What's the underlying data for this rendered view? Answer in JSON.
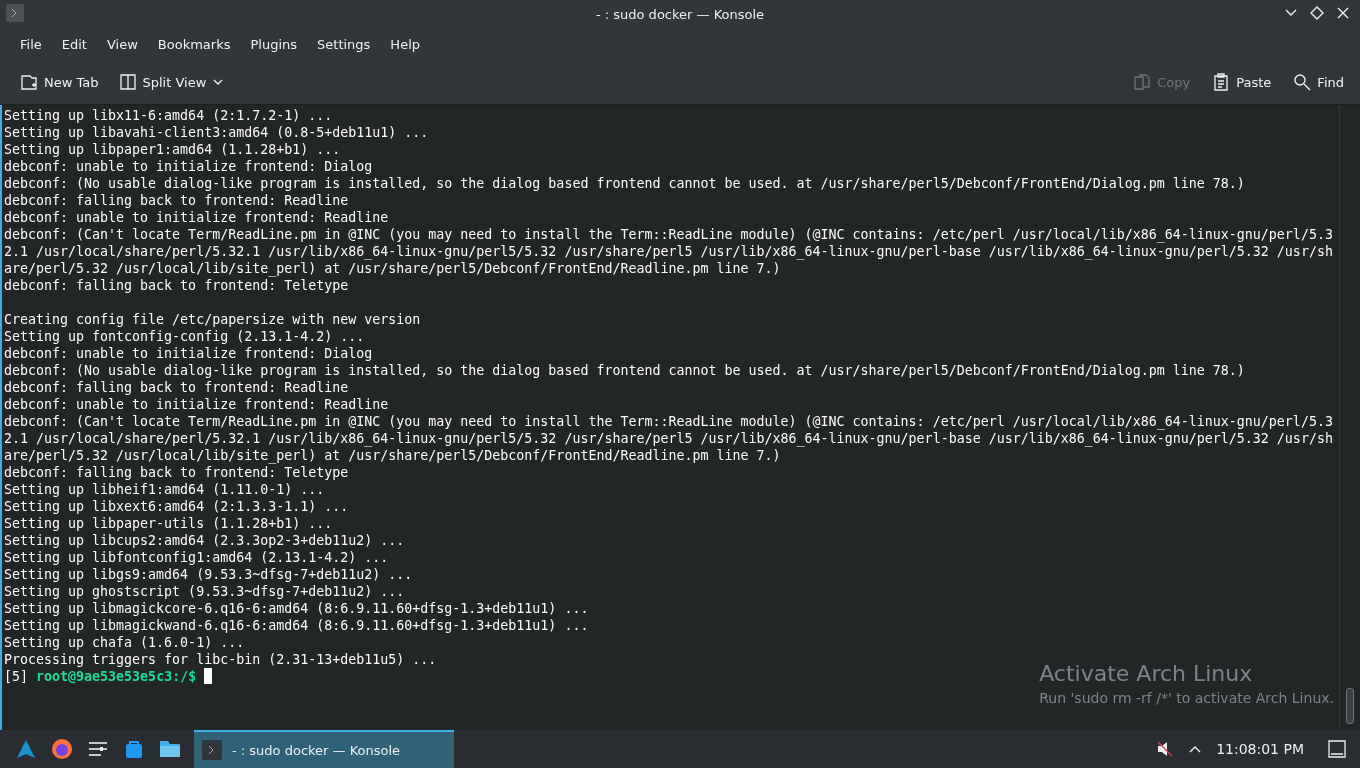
{
  "window": {
    "title": "- : sudo docker — Konsole"
  },
  "menu": [
    "File",
    "Edit",
    "View",
    "Bookmarks",
    "Plugins",
    "Settings",
    "Help"
  ],
  "toolbar": {
    "left": [
      {
        "label": "New Tab",
        "kind": "newtab",
        "disabled": false
      },
      {
        "label": "Split View",
        "kind": "split",
        "disabled": false
      }
    ],
    "right": [
      {
        "label": "Copy",
        "kind": "copy",
        "disabled": true
      },
      {
        "label": "Paste",
        "kind": "paste",
        "disabled": false
      },
      {
        "label": "Find",
        "kind": "find",
        "disabled": false
      }
    ]
  },
  "terminal": {
    "blocks": [
      [
        "Setting up libx11-6:amd64 (2:1.7.2-1) ...",
        "Setting up libavahi-client3:amd64 (0.8-5+deb11u1) ...",
        "Setting up libpaper1:amd64 (1.1.28+b1) ...",
        "debconf: unable to initialize frontend: Dialog",
        "debconf: (No usable dialog-like program is installed, so the dialog based frontend cannot be used. at /usr/share/perl5/Debconf/FrontEnd/Dialog.pm line 78.)",
        "debconf: falling back to frontend: Readline",
        "debconf: unable to initialize frontend: Readline",
        "debconf: (Can't locate Term/ReadLine.pm in @INC (you may need to install the Term::ReadLine module) (@INC contains: /etc/perl /usr/local/lib/x86_64-linux-gnu/perl/5.3",
        "2.1 /usr/local/share/perl/5.32.1 /usr/lib/x86_64-linux-gnu/perl5/5.32 /usr/share/perl5 /usr/lib/x86_64-linux-gnu/perl-base /usr/lib/x86_64-linux-gnu/perl/5.32 /usr/sh",
        "are/perl/5.32 /usr/local/lib/site_perl) at /usr/share/perl5/Debconf/FrontEnd/Readline.pm line 7.)",
        "debconf: falling back to frontend: Teletype"
      ],
      [
        "Creating config file /etc/papersize with new version",
        "Setting up fontconfig-config (2.13.1-4.2) ...",
        "debconf: unable to initialize frontend: Dialog",
        "debconf: (No usable dialog-like program is installed, so the dialog based frontend cannot be used. at /usr/share/perl5/Debconf/FrontEnd/Dialog.pm line 78.)",
        "debconf: falling back to frontend: Readline",
        "debconf: unable to initialize frontend: Readline",
        "debconf: (Can't locate Term/ReadLine.pm in @INC (you may need to install the Term::ReadLine module) (@INC contains: /etc/perl /usr/local/lib/x86_64-linux-gnu/perl/5.3",
        "2.1 /usr/local/share/perl/5.32.1 /usr/lib/x86_64-linux-gnu/perl5/5.32 /usr/share/perl5 /usr/lib/x86_64-linux-gnu/perl-base /usr/lib/x86_64-linux-gnu/perl/5.32 /usr/sh",
        "are/perl/5.32 /usr/local/lib/site_perl) at /usr/share/perl5/Debconf/FrontEnd/Readline.pm line 7.)",
        "debconf: falling back to frontend: Teletype",
        "Setting up libheif1:amd64 (1.11.0-1) ...",
        "Setting up libxext6:amd64 (2:1.3.3-1.1) ...",
        "Setting up libpaper-utils (1.1.28+b1) ...",
        "Setting up libcups2:amd64 (2.3.3op2-3+deb11u2) ...",
        "Setting up libfontconfig1:amd64 (2.13.1-4.2) ...",
        "Setting up libgs9:amd64 (9.53.3~dfsg-7+deb11u2) ...",
        "Setting up ghostscript (9.53.3~dfsg-7+deb11u2) ...",
        "Setting up libmagickcore-6.q16-6:amd64 (8:6.9.11.60+dfsg-1.3+deb11u1) ...",
        "Setting up libmagickwand-6.q16-6:amd64 (8:6.9.11.60+dfsg-1.3+deb11u1) ...",
        "Setting up chafa (1.6.0-1) ...",
        "Processing triggers for libc-bin (2.31-13+deb11u5) ..."
      ]
    ],
    "prompt": {
      "index": "[5]",
      "user_host": "root@9ae53e53e5c3:/$"
    }
  },
  "activation_notice": {
    "title": "Activate Arch Linux",
    "message": "Run 'sudo rm -rf /*' to activate Arch Linux."
  },
  "taskbar": {
    "task": {
      "label": "- : sudo docker — Konsole",
      "selected": true
    },
    "clock": "11:08:01 PM"
  }
}
